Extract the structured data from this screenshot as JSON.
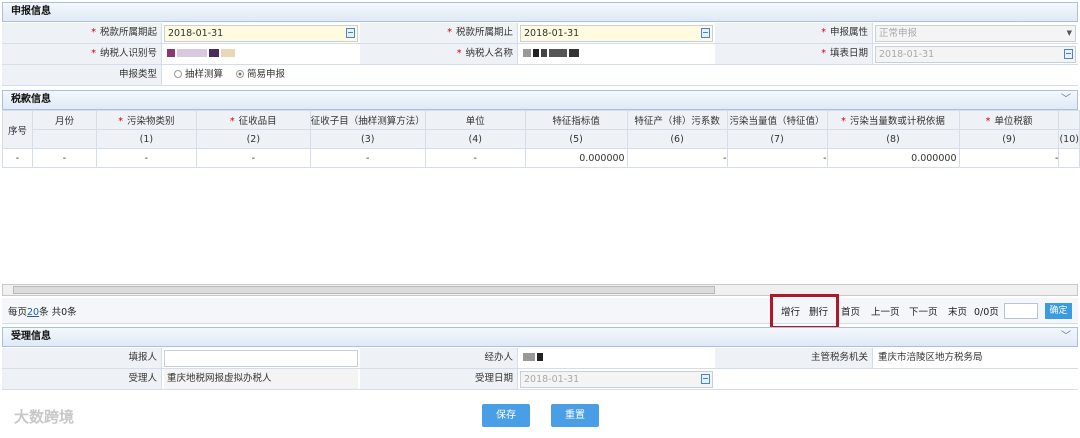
{
  "declare": {
    "title": "申报信息",
    "period_start_label": "税款所属期起",
    "period_start": "2018-01-31",
    "period_end_label": "税款所属期止",
    "period_end": "2018-01-31",
    "attr_label": "申报属性",
    "attr_value": "正常申报",
    "taxpayer_id_label": "纳税人识别号",
    "taxpayer_name_label": "纳税人名称",
    "fill_date_label": "填表日期",
    "fill_date": "2018-01-31",
    "type_label": "申报类型",
    "type_opt1": "抽样测算",
    "type_opt2": "简易申报"
  },
  "tax": {
    "title": "税款信息",
    "headers": [
      "序号",
      "月份",
      "污染物类别",
      "征收品目",
      "征收子目（抽样测算方法）",
      "单位",
      "特征指标值",
      "特征产（排）污系数",
      "污染当量值（特征值）",
      "污染当量数或计税依据",
      "单位税额"
    ],
    "numbers": [
      "(1)",
      "(2)",
      "(3)",
      "(4)",
      "(5)",
      "(6)",
      "(7)",
      "(8)",
      "(9)",
      "(10)"
    ],
    "row": [
      "-",
      "-",
      "-",
      "-",
      "-",
      "-",
      "0.000000",
      "-",
      "-",
      "0.000000",
      "-"
    ]
  },
  "pager": {
    "per_page_prefix": "每页",
    "per_page": "20",
    "per_page_suffix": "条 共0条",
    "add": "增行",
    "del": "删行",
    "first": "首页",
    "prev": "上一页",
    "next": "下一页",
    "last": "末页",
    "pages": "0/0页",
    "ok": "确定"
  },
  "accept": {
    "title": "受理信息",
    "filler_label": "填报人",
    "handler_label": "经办人",
    "authority_label": "主管税务机关",
    "authority": "重庆市涪陵区地方税务局",
    "acceptor_label": "受理人",
    "acceptor": "重庆地税网报虚拟办税人",
    "accept_date_label": "受理日期",
    "accept_date": "2018-01-31"
  },
  "buttons": {
    "save": "保存",
    "reset": "重置"
  },
  "watermark": "大数跨境"
}
